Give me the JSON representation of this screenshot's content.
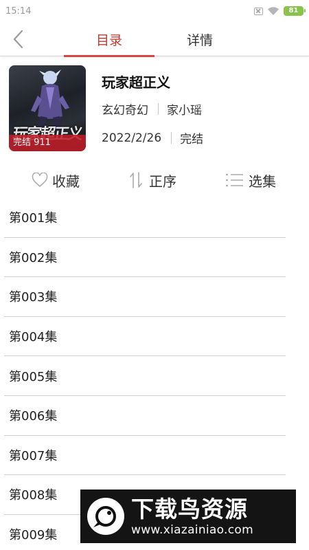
{
  "status_bar": {
    "time": "15:14",
    "battery": "81"
  },
  "tabs": [
    {
      "label": "目录",
      "active": true
    },
    {
      "label": "详情",
      "active": false
    }
  ],
  "colors": {
    "accent": "#d64541",
    "battery": "#8bc34a",
    "divider": "#cfcfcf"
  },
  "book": {
    "title": "玩家超正义",
    "genre": "玄幻奇幻",
    "author": "家小瑶",
    "date": "2022/2/26",
    "status": "完结",
    "cover_label": "完结 911",
    "cover_art_text": "玩家超正义"
  },
  "actions": {
    "favorite": "收藏",
    "sort": "正序",
    "select": "选集"
  },
  "episodes": [
    "第001集",
    "第002集",
    "第003集",
    "第004集",
    "第005集",
    "第006集",
    "第007集",
    "第008集",
    "第009集"
  ],
  "watermark": {
    "name": "下载鸟资源",
    "url": "www.xiazainiao.com"
  }
}
